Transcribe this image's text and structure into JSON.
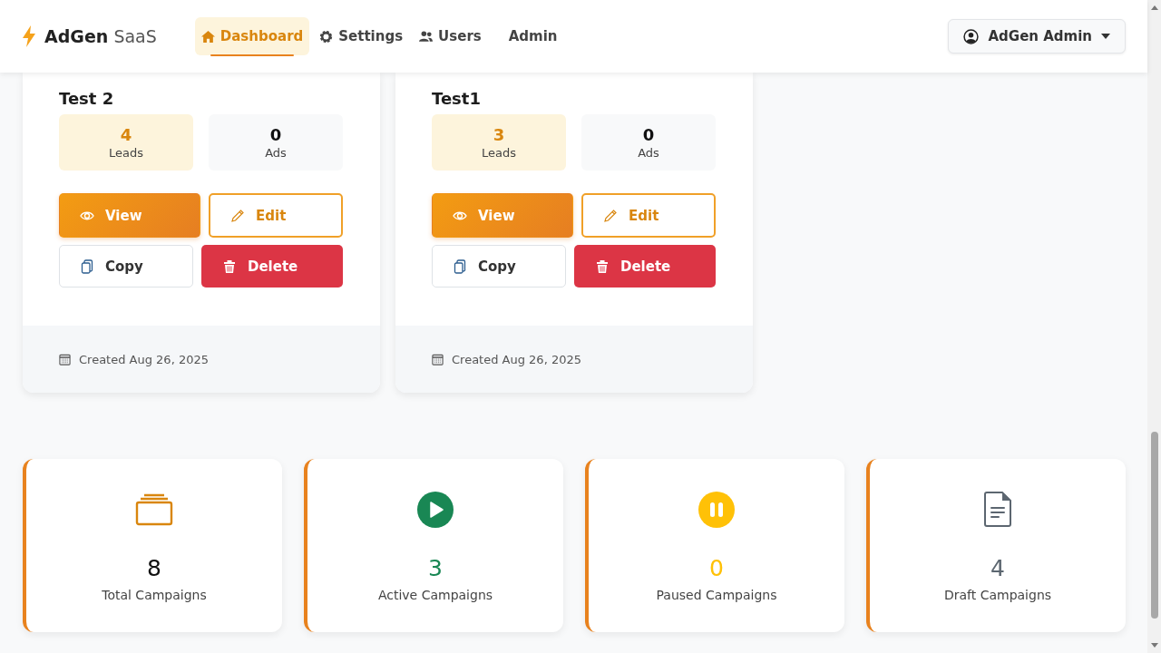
{
  "brand": {
    "name": "AdGen",
    "suffix": "SaaS"
  },
  "nav": [
    {
      "label": "Dashboard",
      "kind": "dashboard",
      "selected": true
    },
    {
      "label": "Settings",
      "kind": "settings",
      "selected": false
    },
    {
      "label": "Users",
      "kind": "users",
      "selected": false
    },
    {
      "label": "Admin",
      "kind": "admin",
      "selected": false
    }
  ],
  "user_menu": {
    "label": "AdGen Admin"
  },
  "campaigns": [
    {
      "name": "Test 2",
      "leads": "4",
      "leads_label": "Leads",
      "ads": "0",
      "ads_label": "Ads",
      "buttons": [
        {
          "kind": "view",
          "label": "View"
        },
        {
          "kind": "edit",
          "label": "Edit"
        },
        {
          "kind": "copy",
          "label": "Copy"
        },
        {
          "kind": "delete",
          "label": "Delete"
        }
      ],
      "created": "Created Aug 26, 2025"
    },
    {
      "name": "Test1",
      "leads": "3",
      "leads_label": "Leads",
      "ads": "0",
      "ads_label": "Ads",
      "buttons": [
        {
          "kind": "view",
          "label": "View"
        },
        {
          "kind": "edit",
          "label": "Edit"
        },
        {
          "kind": "copy",
          "label": "Copy"
        },
        {
          "kind": "delete",
          "label": "Delete"
        }
      ],
      "created": "Created Aug 26, 2025"
    }
  ],
  "stats": [
    {
      "kind": "total",
      "value": "8",
      "label": "Total Campaigns"
    },
    {
      "kind": "active",
      "value": "3",
      "label": "Active Campaigns"
    },
    {
      "kind": "paused",
      "value": "0",
      "label": "Paused Campaigns"
    },
    {
      "kind": "draft",
      "value": "4",
      "label": "Draft Campaigns"
    }
  ]
}
